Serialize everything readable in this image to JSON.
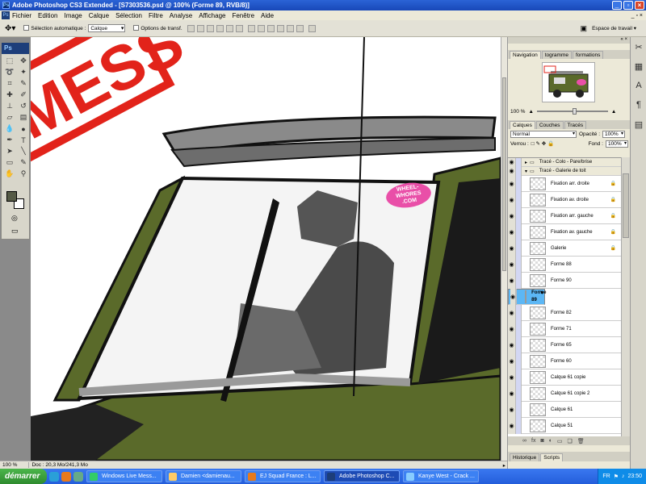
{
  "titlebar": {
    "title": "Adobe Photoshop CS3 Extended - [S7303536.psd @ 100% (Forme 89, RVB/8)]"
  },
  "menu": [
    "Fichier",
    "Edition",
    "Image",
    "Calque",
    "Sélection",
    "Filtre",
    "Analyse",
    "Affichage",
    "Fenêtre",
    "Aide"
  ],
  "options": {
    "auto_select_label": "Sélection automatique :",
    "auto_select_value": "Calque",
    "transform_label": "Options de transf.",
    "workspace_label": "Espace de travail ▾"
  },
  "toolbox": {
    "logo": "Ps"
  },
  "canvas": {
    "sticker_line1": "WHEEL-",
    "sticker_line2": "WHORES",
    "sticker_line3": ".COM",
    "stamp_text": "MESS"
  },
  "statusbar": {
    "zoom": "100 %",
    "doc": "Doc : 20,3 Mo/241,3 Mo"
  },
  "navigator": {
    "tabs": [
      "Navigation",
      "togramme",
      "formations"
    ],
    "zoom": "100 %"
  },
  "layers": {
    "tabs": [
      "Calques",
      "Couches",
      "Tracés"
    ],
    "blend_mode": "Normal",
    "opacity_label": "Opacité :",
    "opacity_value": "100%",
    "lock_label": "Verrou :",
    "fill_label": "Fond :",
    "fill_value": "100%",
    "items": [
      {
        "name": "Tracé - Colo - Pare/brise",
        "type": "group"
      },
      {
        "name": "Tracé - Galerie de toit",
        "type": "group"
      },
      {
        "name": "Fixation arr. droite",
        "locked": true
      },
      {
        "name": "Fixation av. droite",
        "locked": true
      },
      {
        "name": "Fixation arr. gauche",
        "locked": true
      },
      {
        "name": "Fixation av. gauche",
        "locked": true
      },
      {
        "name": "Galerie",
        "locked": true
      },
      {
        "name": "Forme 88"
      },
      {
        "name": "Forme 90"
      },
      {
        "name": "Forme 89",
        "selected": true
      },
      {
        "name": "Forme 82"
      },
      {
        "name": "Forme 71"
      },
      {
        "name": "Forme 65"
      },
      {
        "name": "Forme 60"
      },
      {
        "name": "Calque 61 copie"
      },
      {
        "name": "Calque 61 copie 2"
      },
      {
        "name": "Calque 61"
      },
      {
        "name": "Calque 51"
      }
    ],
    "footer_icons": [
      "link-icon",
      "fx-icon",
      "mask-icon",
      "adjustment-icon",
      "folder-icon",
      "new-layer-icon",
      "trash-icon"
    ]
  },
  "bottom_tabs": [
    "Historique",
    "Scripts"
  ],
  "taskbar": {
    "start": "démarrer",
    "tasks": [
      "Windows Live Mess...",
      "Damien <damienau...",
      "EJ Squad France : L...",
      "Adobe Photoshop C...",
      "Kanye West - Crack ..."
    ],
    "lang": "FR",
    "time": "23:50"
  },
  "colors": {
    "car_green": "#5a6a2a",
    "selection": "#5cb7f5",
    "sticker": "#e94fa8",
    "stamp_red": "#e2231a"
  }
}
